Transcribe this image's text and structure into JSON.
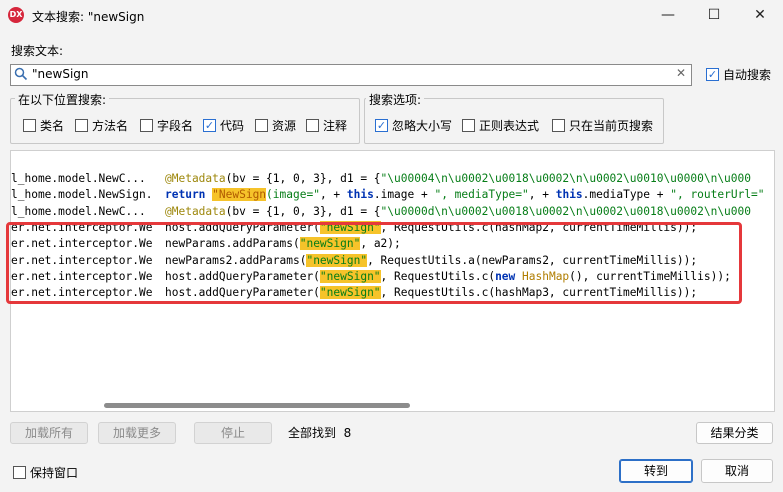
{
  "window": {
    "title": "文本搜索: \"newSign",
    "app_icon_text": "DX",
    "minimize": "—",
    "maximize": "☐",
    "close": "✕"
  },
  "search": {
    "label": "搜索文本:",
    "value": "\"newSign",
    "auto_search_label": "自动搜索",
    "auto_search_checked": true
  },
  "scope": {
    "title": "在以下位置搜索:",
    "options": [
      {
        "label": "类名",
        "checked": false
      },
      {
        "label": "方法名",
        "checked": false
      },
      {
        "label": "字段名",
        "checked": false
      },
      {
        "label": "代码",
        "checked": true
      },
      {
        "label": "资源",
        "checked": false
      },
      {
        "label": "注释",
        "checked": false
      }
    ]
  },
  "options": {
    "title": "搜索选项:",
    "items": [
      {
        "label": "忽略大小写",
        "checked": true
      },
      {
        "label": "正则表达式",
        "checked": false
      },
      {
        "label": "只在当前页搜索",
        "checked": false
      }
    ]
  },
  "results": {
    "rows": [
      {
        "cls": "l_home.model.NewC...",
        "parts": [
          [
            "ann",
            "@Metadata"
          ],
          [
            "",
            "(bv = {1, 0, 3}, d1 = {"
          ],
          [
            "str",
            "\"\\u00004\\n\\u0002\\u0018\\u0002\\n\\u0002\\u0010\\u0000\\n\\u000"
          ]
        ]
      },
      {
        "cls": "l_home.model.NewSign.",
        "parts": [
          [
            "kw",
            "return "
          ],
          [
            "hl2",
            "\"NewSign"
          ],
          [
            "str",
            "(image=\""
          ],
          [
            "",
            ", + "
          ],
          [
            "kw",
            "this"
          ],
          [
            "",
            ".image + "
          ],
          [
            "str",
            "\", mediaType=\""
          ],
          [
            "",
            ", + "
          ],
          [
            "kw",
            "this"
          ],
          [
            "",
            ".mediaType + "
          ],
          [
            "str",
            "\", routerUrl=\""
          ]
        ]
      },
      {
        "cls": "l_home.model.NewC...",
        "parts": [
          [
            "ann",
            "@Metadata"
          ],
          [
            "",
            "(bv = {1, 0, 3}, d1 = {"
          ],
          [
            "str",
            "\"\\u0000d\\n\\u0002\\u0018\\u0002\\n\\u0002\\u0018\\u0002\\n\\u000"
          ]
        ]
      },
      {
        "cls": "er.net.interceptor.We",
        "parts": [
          [
            "",
            "host.addQueryParameter("
          ],
          [
            "hl",
            "\"newSign\""
          ],
          [
            "",
            ", RequestUtils.c(hashMap2, currentTimeMillis));"
          ]
        ]
      },
      {
        "cls": "er.net.interceptor.We",
        "parts": [
          [
            "",
            "newParams.addParams("
          ],
          [
            "hl",
            "\"newSign\""
          ],
          [
            "",
            ", a2);"
          ]
        ]
      },
      {
        "cls": "er.net.interceptor.We",
        "parts": [
          [
            "",
            "newParams2.addParams("
          ],
          [
            "hl",
            "\"newSign\""
          ],
          [
            "",
            ", RequestUtils.a(newParams2, currentTimeMillis));"
          ]
        ]
      },
      {
        "cls": "er.net.interceptor.We",
        "parts": [
          [
            "",
            "host.addQueryParameter("
          ],
          [
            "hl",
            "\"newSign\""
          ],
          [
            "",
            ", RequestUtils.c("
          ],
          [
            "kw",
            "new "
          ],
          [
            "cls-type",
            "HashMap"
          ],
          [
            "",
            "(), currentTimeMillis));"
          ]
        ]
      },
      {
        "cls": "er.net.interceptor.We",
        "parts": [
          [
            "",
            "host.addQueryParameter("
          ],
          [
            "hl",
            "\"newSign\""
          ],
          [
            "",
            ", RequestUtils.c(hashMap3, currentTimeMillis));"
          ]
        ]
      }
    ]
  },
  "footer": {
    "load_all": "加载所有",
    "load_more": "加载更多",
    "stop": "停止",
    "found_text": "全部找到  8",
    "group_results": "结果分类",
    "keep_window_label": "保持窗口",
    "keep_window_checked": false,
    "goto": "转到",
    "cancel": "取消"
  },
  "colors": {
    "highlight": "#f6c32a",
    "annotation_box": "#e5383b",
    "accent": "#2a6fd1"
  }
}
